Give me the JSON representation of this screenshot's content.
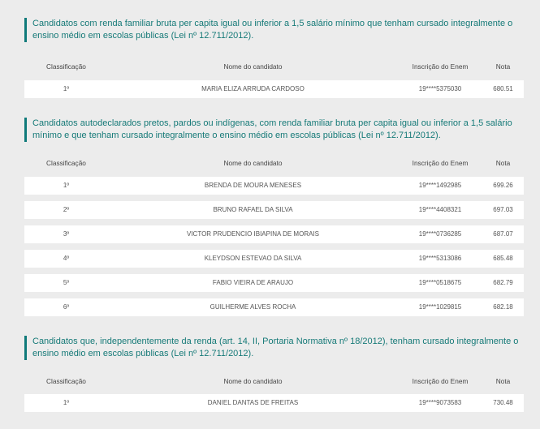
{
  "columns": {
    "rank": "Classificação",
    "name": "Nome do candidato",
    "enem": "Inscrição do Enem",
    "score": "Nota"
  },
  "sections": [
    {
      "title": "Candidatos com renda familiar bruta per capita igual ou inferior a 1,5 salário mínimo que tenham cursado integralmente o ensino médio em escolas públicas (Lei nº 12.711/2012).",
      "rows": [
        {
          "rank": "1º",
          "name": "MARIA ELIZA ARRUDA CARDOSO",
          "enem": "19****5375030",
          "score": "680.51"
        }
      ]
    },
    {
      "title": "Candidatos autodeclarados pretos, pardos ou indígenas, com renda familiar bruta per capita igual ou inferior a 1,5 salário mínimo e que tenham cursado integralmente o ensino médio em escolas públicas (Lei nº 12.711/2012).",
      "rows": [
        {
          "rank": "1º",
          "name": "BRENDA DE MOURA MENESES",
          "enem": "19****1492985",
          "score": "699.26"
        },
        {
          "rank": "2º",
          "name": "BRUNO RAFAEL DA SILVA",
          "enem": "19****4408321",
          "score": "697.03"
        },
        {
          "rank": "3º",
          "name": "VICTOR PRUDENCIO IBIAPINA DE MORAIS",
          "enem": "19****0736285",
          "score": "687.07"
        },
        {
          "rank": "4º",
          "name": "KLEYDSON ESTEVAO DA SILVA",
          "enem": "19****5313086",
          "score": "685.48"
        },
        {
          "rank": "5º",
          "name": "FABIO VIEIRA DE ARAUJO",
          "enem": "19****0518675",
          "score": "682.79"
        },
        {
          "rank": "6º",
          "name": "GUILHERME ALVES ROCHA",
          "enem": "19****1029815",
          "score": "682.18"
        }
      ]
    },
    {
      "title": "Candidatos que, independentemente da renda (art. 14, II, Portaria Normativa nº 18/2012), tenham cursado integralmente o ensino médio em escolas públicas (Lei nº 12.711/2012).",
      "rows": [
        {
          "rank": "1º",
          "name": "DANIEL DANTAS DE FREITAS",
          "enem": "19****9073583",
          "score": "730.48"
        }
      ]
    }
  ]
}
